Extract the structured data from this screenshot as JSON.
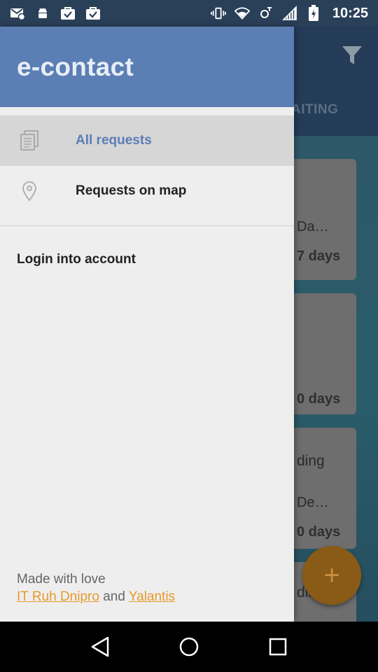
{
  "status_bar": {
    "time": "10:25",
    "left_icons": [
      "mail-icon",
      "android-icon",
      "bag-check-icon",
      "bag-check-icon"
    ],
    "right_icons": [
      "vibrate-icon",
      "wifi-icon",
      "data-saver-icon",
      "signal-icon",
      "battery-charging-icon"
    ]
  },
  "background_app": {
    "tab_label": "AITING",
    "cards": [
      {
        "line1": "",
        "line2": "Da…",
        "days": "7 days"
      },
      {
        "line1": "",
        "line2": "",
        "days": "0 days"
      },
      {
        "line1": "ding",
        "line2": "De…",
        "days": "0 days"
      },
      {
        "line1": "ding",
        "line2": "",
        "days": ""
      }
    ],
    "fab_symbol": "+"
  },
  "drawer": {
    "title": "e-contact",
    "menu": [
      {
        "label": "All requests",
        "icon": "documents-icon",
        "active": true
      },
      {
        "label": "Requests on map",
        "icon": "map-pin-icon",
        "active": false
      }
    ],
    "login_label": "Login into account",
    "footer": {
      "made_with": "Made with love",
      "link1": "IT Ruh Dnipro",
      "and": "and",
      "link2": "Yalantis"
    }
  },
  "colors": {
    "drawer_header": "#5b7fb4",
    "accent_link": "#e69a2a",
    "active_label": "#5a7eb6"
  }
}
